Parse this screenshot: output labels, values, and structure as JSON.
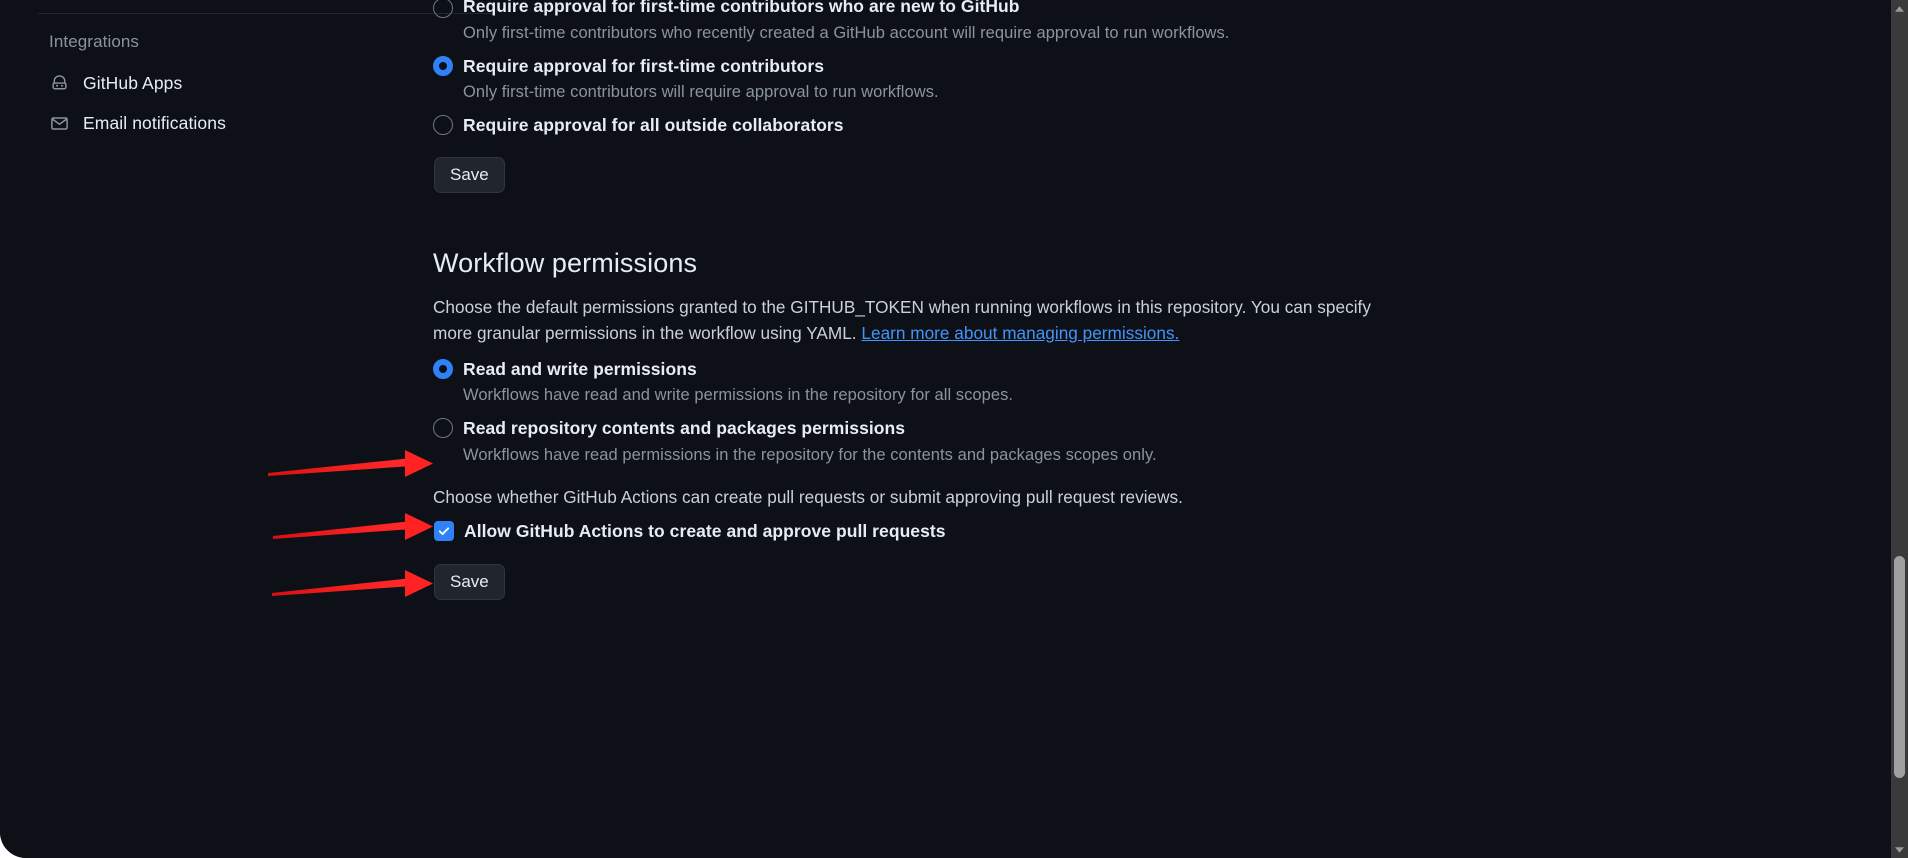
{
  "theme": {
    "background": "#0d1117",
    "accent_blue": "#2f81f7",
    "link_blue": "#4493f8",
    "annotation_red": "#f61f1f",
    "muted_text": "#8b949e",
    "primary_text": "#e6edf3",
    "button_bg": "#21262d"
  },
  "sidebar": {
    "section_title": "Integrations",
    "items": [
      {
        "label": "GitHub Apps",
        "icon": "github-app-icon"
      },
      {
        "label": "Email notifications",
        "icon": "envelope-icon"
      }
    ]
  },
  "fork_pr_approval": {
    "options": [
      {
        "label": "Require approval for first-time contributors who are new to GitHub",
        "description": "Only first-time contributors who recently created a GitHub account will require approval to run workflows.",
        "checked": false
      },
      {
        "label": "Require approval for first-time contributors",
        "description": "Only first-time contributors will require approval to run workflows.",
        "checked": true
      },
      {
        "label": "Require approval for all outside collaborators",
        "description": "",
        "checked": false
      }
    ],
    "save_label": "Save"
  },
  "workflow_permissions": {
    "heading": "Workflow permissions",
    "description_part1": "Choose the default permissions granted to the GITHUB_TOKEN when running workflows in this repository. You can specify more granular permissions in the workflow using YAML. ",
    "link_text": "Learn more about managing permissions.",
    "options": [
      {
        "label": "Read and write permissions",
        "description": "Workflows have read and write permissions in the repository for all scopes.",
        "checked": true
      },
      {
        "label": "Read repository contents and packages permissions",
        "description": "Workflows have read permissions in the repository for the contents and packages scopes only.",
        "checked": false
      }
    ],
    "pr_paragraph": "Choose whether GitHub Actions can create pull requests or submit approving pull request reviews.",
    "checkbox_label": "Allow GitHub Actions to create and approve pull requests",
    "checkbox_checked": true,
    "save_label": "Save"
  },
  "annotations": {
    "arrows": [
      {
        "name": "arrow-to-read-write-radio",
        "target": "Read and write permissions radio"
      },
      {
        "name": "arrow-to-allow-actions-checkbox",
        "target": "Allow GitHub Actions checkbox"
      },
      {
        "name": "arrow-to-save-button",
        "target": "Save button"
      }
    ]
  },
  "scrollbar": {
    "up_arrow": "▲",
    "down_arrow": "▼"
  }
}
